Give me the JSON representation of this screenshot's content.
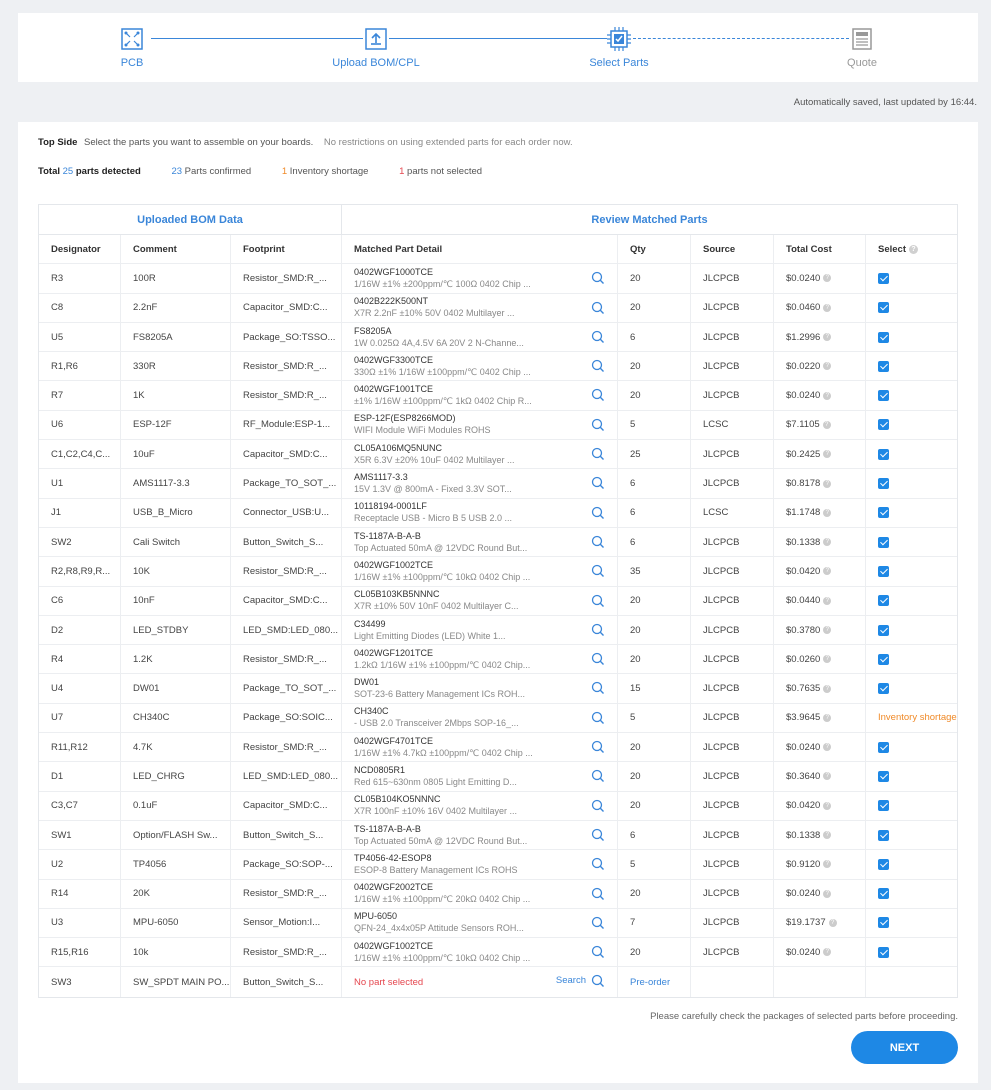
{
  "stepper": {
    "steps": [
      {
        "label": "PCB",
        "icon": "pcb-icon"
      },
      {
        "label": "Upload BOM/CPL",
        "icon": "upload-icon"
      },
      {
        "label": "Select Parts",
        "icon": "chip-icon"
      },
      {
        "label": "Quote",
        "icon": "calculator-icon"
      }
    ]
  },
  "autosave": "Automatically saved, last updated by 16:44.",
  "info": {
    "side_label": "Top Side",
    "instruction": "Select the parts you want to assemble on your boards.",
    "restriction": "No restrictions on using extended parts for each order now.",
    "total_label": "Total",
    "total_count": "25",
    "total_suffix": "parts detected",
    "confirmed_count": "23",
    "confirmed_label": "Parts confirmed",
    "shortage_count": "1",
    "shortage_label": "Inventory shortage",
    "notselected_count": "1",
    "notselected_label": "parts not selected"
  },
  "table": {
    "group_left": "Uploaded BOM Data",
    "group_right": "Review Matched Parts",
    "headers": [
      "Designator",
      "Comment",
      "Footprint",
      "Matched Part Detail",
      "Qty",
      "Source",
      "Total Cost",
      "Select"
    ],
    "rows": [
      {
        "designator": "R3",
        "comment": "100R",
        "footprint": "Resistor_SMD:R_...",
        "part": "0402WGF1000TCE",
        "desc": "1/16W ±1% ±200ppm/℃ 100Ω 0402 Chip ...",
        "qty": "20",
        "source": "JLCPCB",
        "cost": "$0.0240",
        "select": "checked"
      },
      {
        "designator": "C8",
        "comment": "2.2nF",
        "footprint": "Capacitor_SMD:C...",
        "part": "0402B222K500NT",
        "desc": "X7R 2.2nF ±10% 50V 0402 Multilayer ...",
        "qty": "20",
        "source": "JLCPCB",
        "cost": "$0.0460",
        "select": "checked"
      },
      {
        "designator": "U5",
        "comment": "FS8205A",
        "footprint": "Package_SO:TSSO...",
        "part": "FS8205A",
        "desc": "1W 0.025Ω 4A,4.5V 6A 20V 2 N-Channe...",
        "qty": "6",
        "source": "JLCPCB",
        "cost": "$1.2996",
        "select": "checked"
      },
      {
        "designator": "R1,R6",
        "comment": "330R",
        "footprint": "Resistor_SMD:R_...",
        "part": "0402WGF3300TCE",
        "desc": "330Ω ±1% 1/16W ±100ppm/℃ 0402 Chip ...",
        "qty": "20",
        "source": "JLCPCB",
        "cost": "$0.0220",
        "select": "checked"
      },
      {
        "designator": "R7",
        "comment": "1K",
        "footprint": "Resistor_SMD:R_...",
        "part": "0402WGF1001TCE",
        "desc": "±1% 1/16W ±100ppm/℃ 1kΩ 0402 Chip R...",
        "qty": "20",
        "source": "JLCPCB",
        "cost": "$0.0240",
        "select": "checked"
      },
      {
        "designator": "U6",
        "comment": "ESP-12F",
        "footprint": "RF_Module:ESP-1...",
        "part": "ESP-12F(ESP8266MOD)",
        "desc": "WIFI Module WiFi Modules ROHS",
        "qty": "5",
        "source": "LCSC",
        "cost": "$7.1105",
        "select": "checked"
      },
      {
        "designator": "C1,C2,C4,C...",
        "comment": "10uF",
        "footprint": "Capacitor_SMD:C...",
        "part": "CL05A106MQ5NUNC",
        "desc": "X5R 6.3V ±20% 10uF 0402 Multilayer ...",
        "qty": "25",
        "source": "JLCPCB",
        "cost": "$0.2425",
        "select": "checked"
      },
      {
        "designator": "U1",
        "comment": "AMS1117-3.3",
        "footprint": "Package_TO_SOT_...",
        "part": "AMS1117-3.3",
        "desc": "15V 1.3V @ 800mA - Fixed 3.3V SOT...",
        "qty": "6",
        "source": "JLCPCB",
        "cost": "$0.8178",
        "select": "checked"
      },
      {
        "designator": "J1",
        "comment": "USB_B_Micro",
        "footprint": "Connector_USB:U...",
        "part": "10118194-0001LF",
        "desc": "Receptacle USB - Micro B 5 USB 2.0 ...",
        "qty": "6",
        "source": "LCSC",
        "cost": "$1.1748",
        "select": "checked"
      },
      {
        "designator": "SW2",
        "comment": "Cali Switch",
        "footprint": "Button_Switch_S...",
        "part": "TS-1187A-B-A-B",
        "desc": "Top Actuated 50mA @ 12VDC Round But...",
        "qty": "6",
        "source": "JLCPCB",
        "cost": "$0.1338",
        "select": "checked"
      },
      {
        "designator": "R2,R8,R9,R...",
        "comment": "10K",
        "footprint": "Resistor_SMD:R_...",
        "part": "0402WGF1002TCE",
        "desc": "1/16W ±1% ±100ppm/℃ 10kΩ 0402 Chip ...",
        "qty": "35",
        "source": "JLCPCB",
        "cost": "$0.0420",
        "select": "checked"
      },
      {
        "designator": "C6",
        "comment": "10nF",
        "footprint": "Capacitor_SMD:C...",
        "part": "CL05B103KB5NNNC",
        "desc": "X7R ±10% 50V 10nF 0402 Multilayer C...",
        "qty": "20",
        "source": "JLCPCB",
        "cost": "$0.0440",
        "select": "checked"
      },
      {
        "designator": "D2",
        "comment": "LED_STDBY",
        "footprint": "LED_SMD:LED_080...",
        "part": "C34499",
        "desc": "Light Emitting Diodes (LED) White 1...",
        "qty": "20",
        "source": "JLCPCB",
        "cost": "$0.3780",
        "select": "checked"
      },
      {
        "designator": "R4",
        "comment": "1.2K",
        "footprint": "Resistor_SMD:R_...",
        "part": "0402WGF1201TCE",
        "desc": "1.2kΩ 1/16W ±1% ±100ppm/℃ 0402 Chip...",
        "qty": "20",
        "source": "JLCPCB",
        "cost": "$0.0260",
        "select": "checked"
      },
      {
        "designator": "U4",
        "comment": "DW01",
        "footprint": "Package_TO_SOT_...",
        "part": "DW01",
        "desc": "SOT-23-6 Battery Management ICs ROH...",
        "qty": "15",
        "source": "JLCPCB",
        "cost": "$0.7635",
        "select": "checked"
      },
      {
        "designator": "U7",
        "comment": "CH340C",
        "footprint": "Package_SO:SOIC...",
        "part": "CH340C",
        "desc": "- USB 2.0 Transceiver 2Mbps SOP-16_...",
        "qty": "5",
        "source": "JLCPCB",
        "cost": "$3.9645",
        "select": "Inventory shortage"
      },
      {
        "designator": "R11,R12",
        "comment": "4.7K",
        "footprint": "Resistor_SMD:R_...",
        "part": "0402WGF4701TCE",
        "desc": "1/16W ±1% 4.7kΩ ±100ppm/℃ 0402 Chip ...",
        "qty": "20",
        "source": "JLCPCB",
        "cost": "$0.0240",
        "select": "checked"
      },
      {
        "designator": "D1",
        "comment": "LED_CHRG",
        "footprint": "LED_SMD:LED_080...",
        "part": "NCD0805R1",
        "desc": "Red 615~630nm 0805 Light Emitting D...",
        "qty": "20",
        "source": "JLCPCB",
        "cost": "$0.3640",
        "select": "checked"
      },
      {
        "designator": "C3,C7",
        "comment": "0.1uF",
        "footprint": "Capacitor_SMD:C...",
        "part": "CL05B104KO5NNNC",
        "desc": "X7R 100nF ±10% 16V 0402 Multilayer ...",
        "qty": "20",
        "source": "JLCPCB",
        "cost": "$0.0420",
        "select": "checked"
      },
      {
        "designator": "SW1",
        "comment": "Option/FLASH Sw...",
        "footprint": "Button_Switch_S...",
        "part": "TS-1187A-B-A-B",
        "desc": "Top Actuated 50mA @ 12VDC Round But...",
        "qty": "6",
        "source": "JLCPCB",
        "cost": "$0.1338",
        "select": "checked"
      },
      {
        "designator": "U2",
        "comment": "TP4056",
        "footprint": "Package_SO:SOP-...",
        "part": "TP4056-42-ESOP8",
        "desc": "ESOP-8 Battery Management ICs ROHS",
        "qty": "5",
        "source": "JLCPCB",
        "cost": "$0.9120",
        "select": "checked"
      },
      {
        "designator": "R14",
        "comment": "20K",
        "footprint": "Resistor_SMD:R_...",
        "part": "0402WGF2002TCE",
        "desc": "1/16W ±1% ±100ppm/℃ 20kΩ 0402 Chip ...",
        "qty": "20",
        "source": "JLCPCB",
        "cost": "$0.0240",
        "select": "checked"
      },
      {
        "designator": "U3",
        "comment": "MPU-6050",
        "footprint": "Sensor_Motion:I...",
        "part": "MPU-6050",
        "desc": "QFN-24_4x4x05P Attitude Sensors ROH...",
        "qty": "7",
        "source": "JLCPCB",
        "cost": "$19.1737",
        "select": "checked"
      },
      {
        "designator": "R15,R16",
        "comment": "10k",
        "footprint": "Resistor_SMD:R_...",
        "part": "0402WGF1002TCE",
        "desc": "1/16W ±1% ±100ppm/℃ 10kΩ 0402 Chip ...",
        "qty": "20",
        "source": "JLCPCB",
        "cost": "$0.0240",
        "select": "checked"
      },
      {
        "designator": "SW3",
        "comment": "SW_SPDT MAIN PO...",
        "footprint": "Button_Switch_S...",
        "part": "",
        "desc": "",
        "no_part": "No part selected",
        "search_label": "Search",
        "qty": "Pre-order",
        "source": "",
        "cost": "",
        "select": ""
      }
    ]
  },
  "footer": {
    "note": "Please carefully check the packages of selected parts before proceeding.",
    "next": "NEXT"
  },
  "colors": {
    "accent": "#1e88e5",
    "link": "#3a86d9",
    "warning": "#f08a28",
    "error": "#e5474f"
  }
}
